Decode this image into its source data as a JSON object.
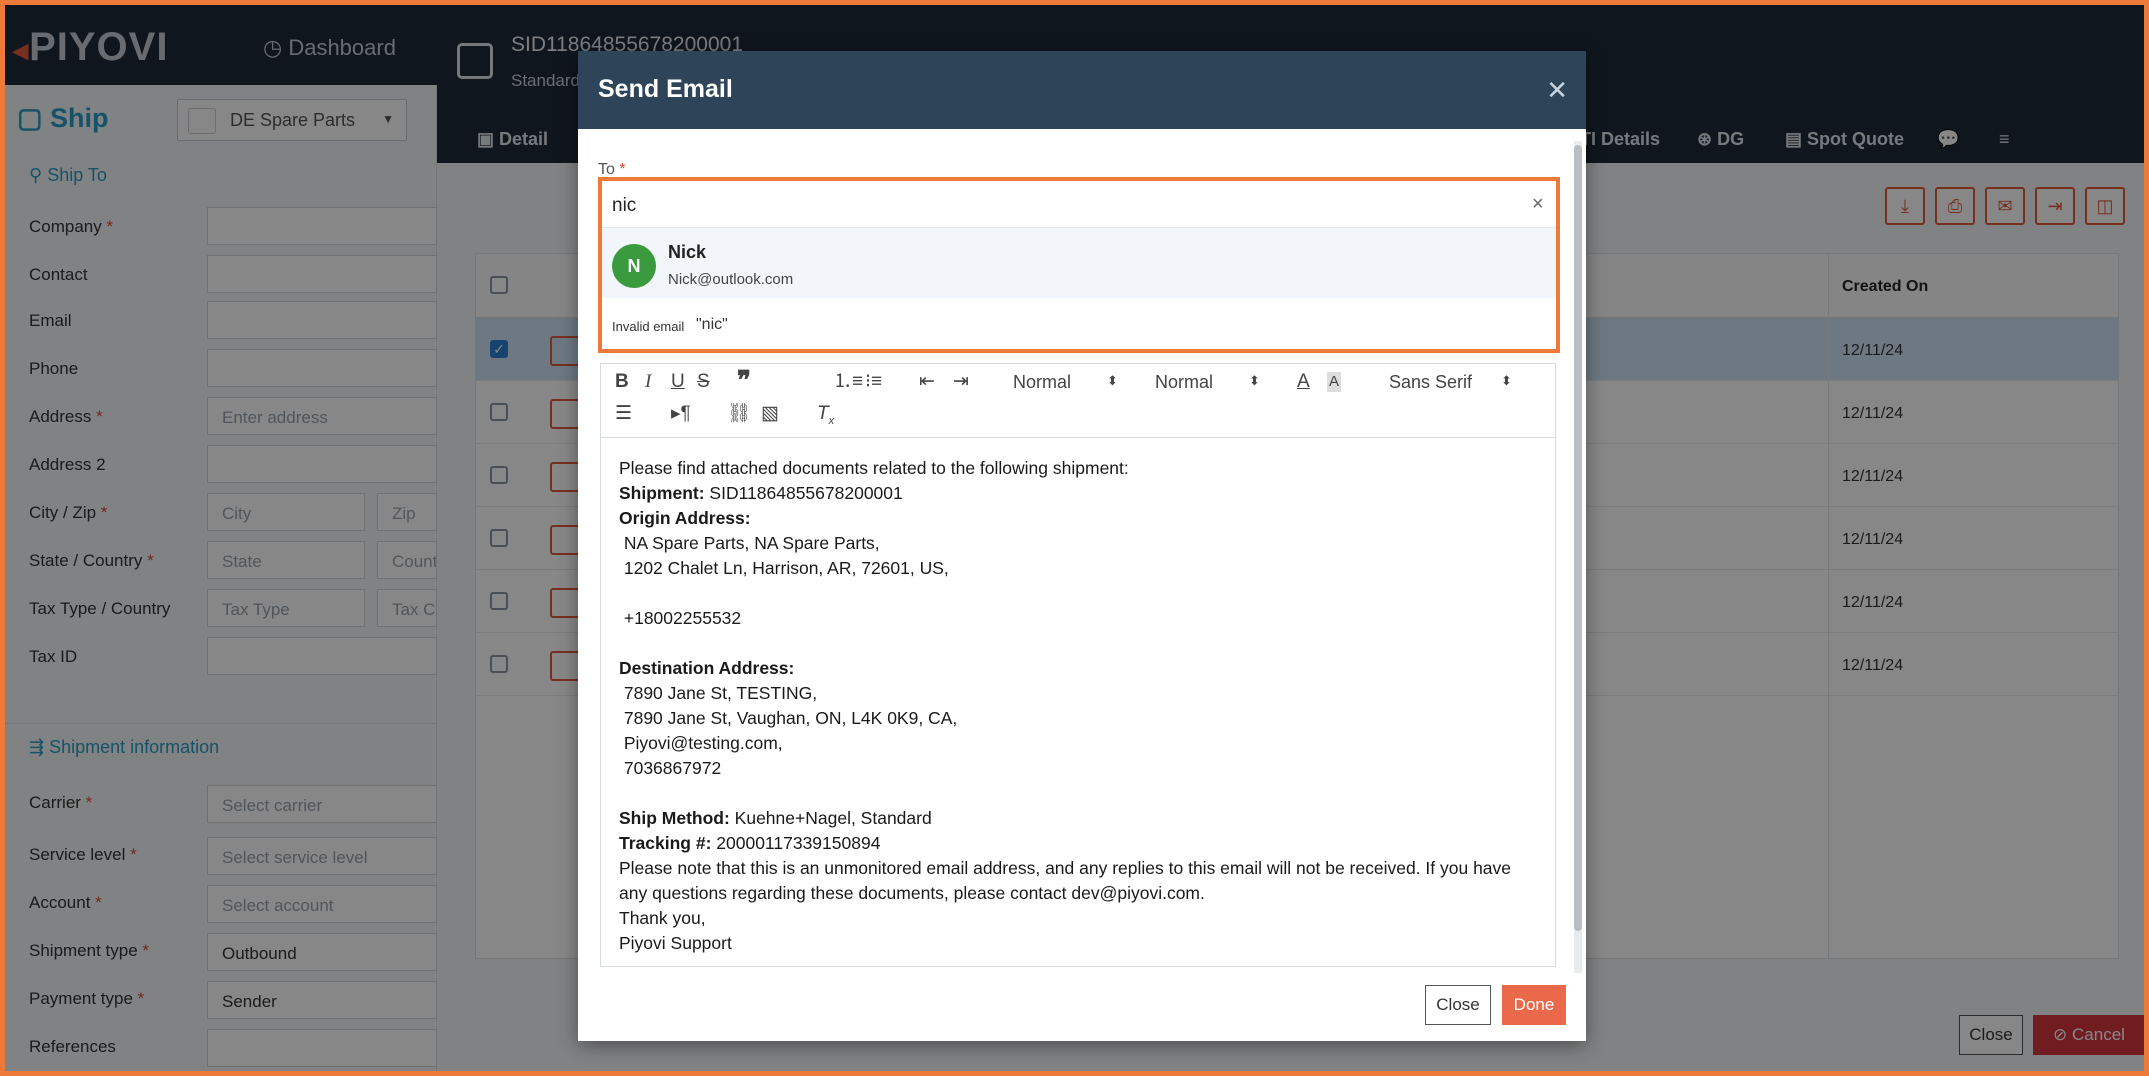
{
  "app": {
    "logo": "PIYOVI",
    "nav_dashboard": "Dashboard",
    "page_title": "Ship",
    "location_select": "DE Spare Parts"
  },
  "ship_form": {
    "ship_to_heading": "Ship To",
    "fields": [
      {
        "label": "Company",
        "required": true
      },
      {
        "label": "Contact",
        "required": false
      },
      {
        "label": "Email",
        "required": false
      },
      {
        "label": "Phone",
        "required": false
      },
      {
        "label": "Address",
        "required": true,
        "placeholder": "Enter address"
      },
      {
        "label": "Address 2",
        "required": false
      },
      {
        "label": "City / Zip",
        "required": true,
        "placeholder": "City",
        "placeholder2": "Zip"
      },
      {
        "label": "State / Country",
        "required": true,
        "placeholder": "State",
        "placeholder2": "Count"
      },
      {
        "label": "Tax Type / Country",
        "required": false,
        "placeholder": "Tax Type",
        "placeholder2": "Tax Co"
      },
      {
        "label": "Tax ID",
        "required": false
      }
    ],
    "shipment_heading": "Shipment information",
    "shipment_fields": [
      {
        "label": "Carrier",
        "required": true,
        "value": "Select carrier"
      },
      {
        "label": "Service level",
        "required": true,
        "value": "Select service level"
      },
      {
        "label": "Account",
        "required": true,
        "value": "Select account"
      },
      {
        "label": "Shipment type",
        "required": true,
        "value": "Outbound"
      },
      {
        "label": "Payment type",
        "required": true,
        "value": "Sender"
      },
      {
        "label": "References",
        "required": false,
        "value": ""
      }
    ]
  },
  "shipment_header": {
    "sid": "SID11864855678200001",
    "subtitle": "Standard",
    "tabs": [
      "Detail",
      "TI Details",
      "DG",
      "Spot Quote"
    ]
  },
  "grid": {
    "created_on_header": "Created On",
    "rows": [
      {
        "date": "12/11/24",
        "selected": true
      },
      {
        "date": "12/11/24",
        "selected": false
      },
      {
        "date": "12/11/24",
        "selected": false
      },
      {
        "date": "12/11/24",
        "selected": false
      },
      {
        "date": "12/11/24",
        "selected": false
      },
      {
        "date": "12/11/24",
        "selected": false
      }
    ]
  },
  "page_footer": {
    "close_label": "Close",
    "cancel_label": "Cancel"
  },
  "modal": {
    "title": "Send Email",
    "to_label": "To",
    "to_value": "nic",
    "suggestion": {
      "initial": "N",
      "name": "Nick",
      "email": "Nick@outlook.com"
    },
    "invalid_label": "Invalid email",
    "invalid_value": "\"nic\"",
    "toolbar": {
      "header_select": "Normal",
      "size_select": "Normal",
      "font_select": "Sans Serif"
    },
    "body_lines": [
      {
        "bold": "",
        "text": "Please find attached documents related to the following shipment:"
      },
      {
        "bold": "Shipment:",
        "text": " SID11864855678200001"
      },
      {
        "bold": "Origin Address:",
        "text": ""
      },
      {
        "bold": "",
        "text": " NA Spare Parts, NA Spare Parts,"
      },
      {
        "bold": "",
        "text": " 1202 Chalet Ln, Harrison, AR, 72601, US,"
      },
      {
        "bold": "",
        "text": ""
      },
      {
        "bold": "",
        "text": " +18002255532"
      },
      {
        "bold": "",
        "text": ""
      },
      {
        "bold": "Destination Address:",
        "text": ""
      },
      {
        "bold": "",
        "text": " 7890 Jane St, TESTING,"
      },
      {
        "bold": "",
        "text": " 7890 Jane St, Vaughan, ON, L4K 0K9, CA,"
      },
      {
        "bold": "",
        "text": " Piyovi@testing.com,"
      },
      {
        "bold": "",
        "text": " 7036867972"
      },
      {
        "bold": "",
        "text": ""
      },
      {
        "bold": "Ship Method:",
        "text": " Kuehne+Nagel, Standard"
      },
      {
        "bold": "Tracking #:",
        "text": " 20000117339150894"
      },
      {
        "bold": "",
        "text": "Please note that this is an unmonitored email address, and any replies to this email will not be received. If you have"
      },
      {
        "bold": "",
        "text": "any questions regarding these documents, please contact dev@piyovi.com."
      },
      {
        "bold": "",
        "text": "Thank you,"
      },
      {
        "bold": "",
        "text": "Piyovi Support"
      }
    ],
    "close_label": "Close",
    "done_label": "Done"
  }
}
